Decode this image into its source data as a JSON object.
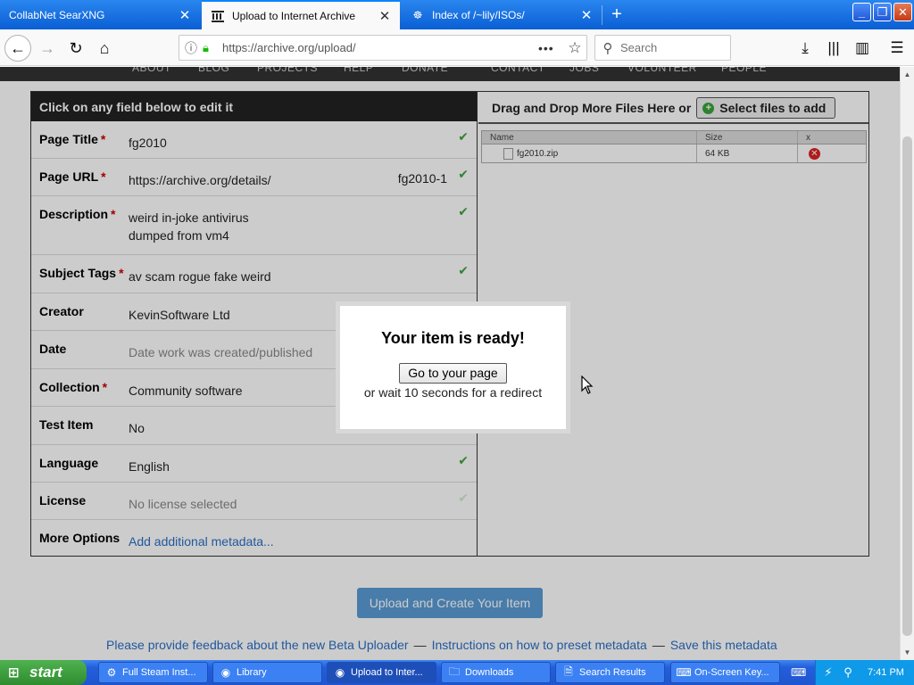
{
  "browser": {
    "tabs": [
      {
        "title": "CollabNet SearXNG",
        "active": false
      },
      {
        "title": "Upload to Internet Archive",
        "active": true
      },
      {
        "title": "Index of /~lily/ISOs/",
        "active": false
      }
    ],
    "url": "https://archive.org/upload/",
    "search_placeholder": "Search"
  },
  "site_nav": [
    "ABOUT",
    "BLOG",
    "PROJECTS",
    "HELP",
    "DONATE",
    "CONTACT",
    "JOBS",
    "VOLUNTEER",
    "PEOPLE"
  ],
  "metadata": {
    "header": "Click on any field below to edit it",
    "rows": [
      {
        "label": "Page Title",
        "required": "*",
        "value": "fg2010"
      },
      {
        "label": "Page URL",
        "required": "*",
        "value": "https://archive.org/details/",
        "suffix": "fg2010-1"
      },
      {
        "label": "Description",
        "required": "*",
        "value_line1": "weird in-joke antivirus",
        "value_line2": "dumped from vm4"
      },
      {
        "label": "Subject Tags",
        "required": "*",
        "value": "av scam rogue fake weird"
      },
      {
        "label": "Creator",
        "required": "",
        "value": "KevinSoftware Ltd"
      },
      {
        "label": "Date",
        "required": "",
        "value": "Date work was created/published"
      },
      {
        "label": "Collection",
        "required": "*",
        "value": "Community software"
      },
      {
        "label": "Test Item",
        "required": "",
        "value": "No"
      },
      {
        "label": "Language",
        "required": "",
        "value": "English"
      },
      {
        "label": "License",
        "required": "",
        "value": "No license selected"
      },
      {
        "label": "More Options",
        "required": "",
        "value": "Add additional metadata..."
      }
    ]
  },
  "files": {
    "drop_text": "Drag and Drop More Files Here or",
    "select_button": "Select files to add",
    "columns": [
      "Name",
      "Size",
      "x"
    ],
    "rows": [
      {
        "name": "fg2010.zip",
        "size": "64 KB"
      }
    ]
  },
  "upload_button": "Upload and Create Your Item",
  "footer": {
    "link1": "Please provide feedback about the new Beta Uploader",
    "link2": "Instructions on how to preset metadata",
    "link3": "Save this metadata",
    "sep": "—"
  },
  "modal": {
    "title": "Your item is ready!",
    "button": "Go to your page",
    "wait_text": "or wait 10 seconds for a redirect"
  },
  "taskbar": {
    "start": "start",
    "tasks": [
      {
        "label": "Full Steam Inst...",
        "active": false
      },
      {
        "label": "Library",
        "active": false
      },
      {
        "label": "Upload to Inter...",
        "active": true
      },
      {
        "label": "Downloads",
        "active": false
      },
      {
        "label": "Search Results",
        "active": false
      },
      {
        "label": "On-Screen Key...",
        "active": false
      }
    ],
    "clock": "7:41 PM"
  }
}
